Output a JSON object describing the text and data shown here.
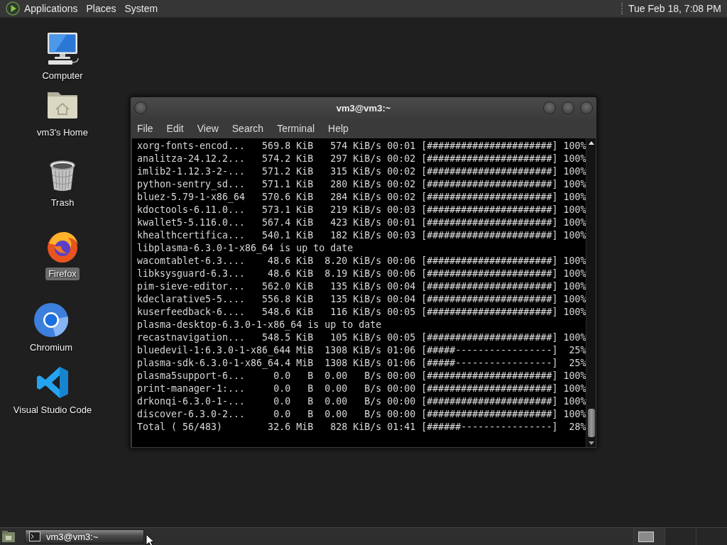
{
  "top_panel": {
    "menus": [
      "Applications",
      "Places",
      "System"
    ],
    "clock": "Tue Feb 18, 7:08 PM"
  },
  "desktop_icons": [
    {
      "label": "Computer",
      "kind": "computer",
      "selected": false
    },
    {
      "label": "vm3's Home",
      "kind": "home",
      "selected": false
    },
    {
      "label": "Trash",
      "kind": "trash",
      "selected": false
    },
    {
      "label": "Firefox",
      "kind": "firefox",
      "selected": true
    },
    {
      "label": "Chromium",
      "kind": "chromium",
      "selected": false
    },
    {
      "label": "Visual Studio Code",
      "kind": "vscode",
      "selected": false
    }
  ],
  "terminal_window": {
    "title": "vm3@vm3:~",
    "menu": [
      "File",
      "Edit",
      "View",
      "Search",
      "Terminal",
      "Help"
    ],
    "lines": [
      "xorg-fonts-encod...   569.8 KiB   574 KiB/s 00:01 [######################] 100%",
      "analitza-24.12.2...   574.2 KiB   297 KiB/s 00:02 [######################] 100%",
      "imlib2-1.12.3-2-...   571.2 KiB   315 KiB/s 00:02 [######################] 100%",
      "python-sentry_sd...   571.1 KiB   280 KiB/s 00:02 [######################] 100%",
      "bluez-5.79-1-x86_64   570.6 KiB   284 KiB/s 00:02 [######################] 100%",
      "kdoctools-6.11.0...   573.1 KiB   219 KiB/s 00:03 [######################] 100%",
      "kwallet5-5.116.0...   567.4 KiB   423 KiB/s 00:01 [######################] 100%",
      "khealthcertifica...   540.1 KiB   182 KiB/s 00:03 [######################] 100%",
      "libplasma-6.3.0-1-x86_64 is up to date",
      "wacomtablet-6.3....    48.6 KiB  8.20 KiB/s 00:06 [######################] 100%",
      "libksysguard-6.3...    48.6 KiB  8.19 KiB/s 00:06 [######################] 100%",
      "pim-sieve-editor...   562.0 KiB   135 KiB/s 00:04 [######################] 100%",
      "kdeclarative5-5....   556.8 KiB   135 KiB/s 00:04 [######################] 100%",
      "kuserfeedback-6....   548.6 KiB   116 KiB/s 00:05 [######################] 100%",
      "plasma-desktop-6.3.0-1-x86_64 is up to date",
      "recastnavigation...   548.5 KiB   105 KiB/s 00:05 [######################] 100%",
      "bluedevil-1:6.3.0-1-x86_644 MiB  1308 KiB/s 01:06 [#####-----------------]  25%",
      "plasma-sdk-6.3.0-1-x86_64.4 MiB  1308 KiB/s 01:06 [#####-----------------]  25%",
      "plasma5support-6...     0.0   B  0.00   B/s 00:00 [######################] 100%",
      "print-manager-1:...     0.0   B  0.00   B/s 00:00 [######################] 100%",
      "drkonqi-6.3.0-1-...     0.0   B  0.00   B/s 00:00 [######################] 100%",
      "discover-6.3.0-2...     0.0   B  0.00   B/s 00:00 [######################] 100%",
      "Total ( 56/483)        32.6 MiB   828 KiB/s 01:41 [######----------------]  28%"
    ]
  },
  "taskbar": {
    "tasks": [
      {
        "label": "vm3@vm3:~"
      }
    ],
    "workspaces": [
      {
        "selected": true
      },
      {
        "selected": false
      },
      {
        "selected": false
      }
    ]
  }
}
